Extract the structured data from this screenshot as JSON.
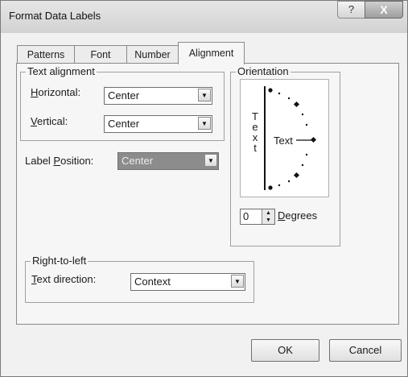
{
  "window": {
    "title": "Format Data Labels",
    "help_glyph": "?",
    "close_glyph": "X"
  },
  "tabs": [
    {
      "label": "Patterns"
    },
    {
      "label": "Font"
    },
    {
      "label": "Number"
    },
    {
      "label": "Alignment",
      "active": true
    }
  ],
  "text_alignment": {
    "group_label": "Text alignment",
    "horizontal": {
      "label_key": "H",
      "label_rest": "orizontal:",
      "value": "Center"
    },
    "vertical": {
      "label_key": "V",
      "label_rest": "ertical:",
      "value": "Center"
    }
  },
  "label_position": {
    "label_pre": "Label ",
    "label_key": "P",
    "label_post": "osition:",
    "value": "Center"
  },
  "orientation": {
    "group_label": "Orientation",
    "vertical_text": [
      "T",
      "e",
      "x",
      "t"
    ],
    "dial_text": "Text",
    "degrees_value": "0",
    "degrees_label_key": "D",
    "degrees_label_rest": "egrees"
  },
  "right_to_left": {
    "group_label": "Right-to-left",
    "text_direction": {
      "label_key": "T",
      "label_rest": "ext direction:",
      "value": "Context"
    }
  },
  "buttons": {
    "ok": "OK",
    "cancel": "Cancel"
  }
}
